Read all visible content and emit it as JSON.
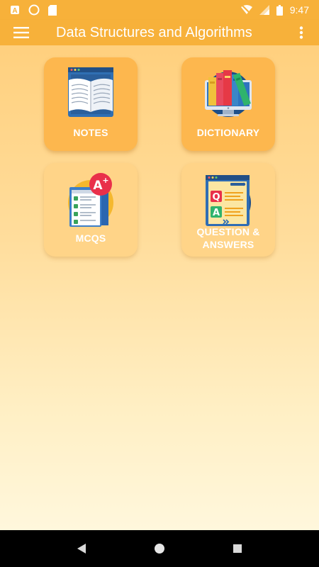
{
  "status_bar": {
    "time": "9:47",
    "icons": [
      "notification-a-icon",
      "circle-icon",
      "sd-card-icon",
      "wifi-icon",
      "signal-icon",
      "battery-icon"
    ]
  },
  "app_bar": {
    "title": "Data Structures and Algorithms",
    "menu_icon": "hamburger-menu-icon",
    "overflow_icon": "more-vert-icon"
  },
  "tiles": [
    {
      "label": "NOTES",
      "icon": "open-book-icon"
    },
    {
      "label": "DICTIONARY",
      "icon": "books-on-monitor-icon"
    },
    {
      "label": "MCQS",
      "icon": "a-plus-checklist-icon"
    },
    {
      "label": "QUESTION & ANSWERS",
      "label_line1": "QUESTION &",
      "label_line2": "ANSWERS",
      "icon": "q-and-a-document-icon"
    }
  ],
  "nav_bar": {
    "back_icon": "back-triangle-icon",
    "home_icon": "home-circle-icon",
    "recents_icon": "recents-square-icon"
  },
  "colors": {
    "app_bar": "#f7b13a",
    "tile": "#fdb74e",
    "tile_light": "#ffd488",
    "background_top": "#ffd07e",
    "background_bottom": "#fff7dc"
  }
}
